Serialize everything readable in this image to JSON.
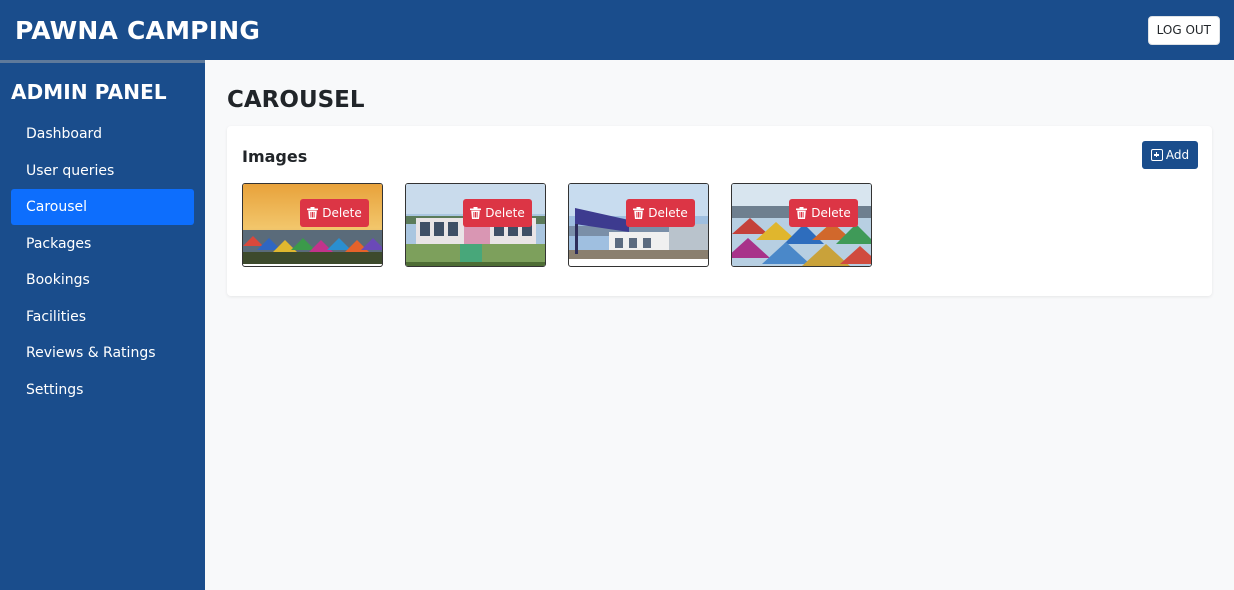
{
  "header": {
    "brand": "PAWNA CAMPING",
    "logout_label": "LOG OUT"
  },
  "sidebar": {
    "title": "ADMIN PANEL",
    "items": [
      {
        "label": "Dashboard"
      },
      {
        "label": "User queries"
      },
      {
        "label": "Carousel"
      },
      {
        "label": "Packages"
      },
      {
        "label": "Bookings"
      },
      {
        "label": "Facilities"
      },
      {
        "label": "Reviews & Ratings"
      },
      {
        "label": "Settings"
      }
    ],
    "active_index": 2
  },
  "main": {
    "page_title": "CAROUSEL",
    "card": {
      "title": "Images",
      "add_label": "Add",
      "images": [
        {
          "delete_label": "Delete"
        },
        {
          "delete_label": "Delete"
        },
        {
          "delete_label": "Delete"
        },
        {
          "delete_label": "Delete"
        }
      ]
    }
  },
  "colors": {
    "primary": "#1a4d8c",
    "active": "#0d6efd",
    "danger": "#dc3545",
    "background": "#f8f9fa"
  },
  "icons": {
    "delete": "trash-icon",
    "add": "plus-square-icon"
  }
}
